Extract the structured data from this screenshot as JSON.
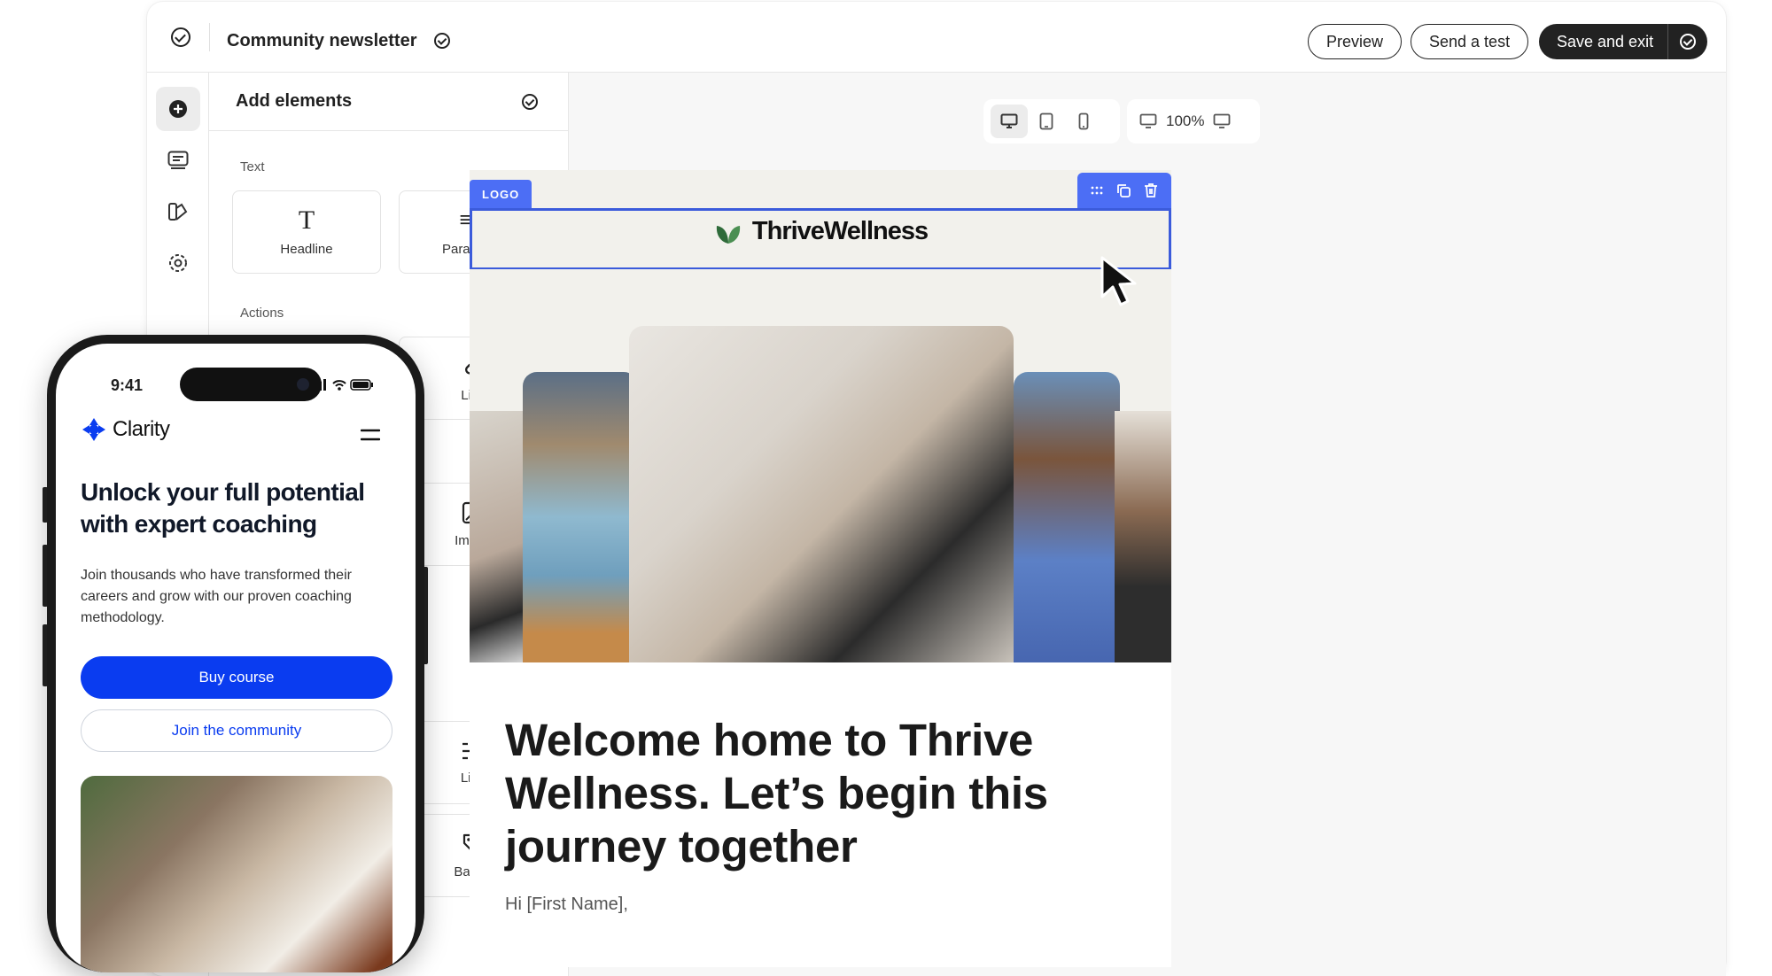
{
  "topbar": {
    "title": "Community newsletter",
    "preview_label": "Preview",
    "send_test_label": "Send a test",
    "save_exit_label": "Save and exit"
  },
  "rail": {
    "items": [
      "add-element-icon",
      "content-blocks-icon",
      "styles-icon",
      "settings-icon"
    ]
  },
  "panel": {
    "title": "Add elements",
    "sections": {
      "text": "Text",
      "actions": "Actions"
    },
    "tiles": {
      "headline": "Headline",
      "paragraph": "Paragraph",
      "link": "Link",
      "image": "Image",
      "line": "Line",
      "badge": "Badge"
    }
  },
  "canvas": {
    "zoom": "100%",
    "email": {
      "logo_tag": "LOGO",
      "brand_name": "ThriveWellness",
      "headline": "Welcome home to Thrive Wellness. Let’s begin this journey together",
      "greeting": "Hi [First Name],"
    }
  },
  "phone": {
    "time": "9:41",
    "brand": "Clarity",
    "headline": "Unlock your full potential with expert coaching",
    "body": "Join thousands who have transformed their careers and grow with our proven coaching methodology.",
    "primary_cta": "Buy course",
    "secondary_cta": "Join the community"
  },
  "colors": {
    "accent": "#4c6ef5",
    "phone_cta": "#0a3cf0",
    "dark": "#222222",
    "brand_leaf": "#2f6b3a"
  }
}
